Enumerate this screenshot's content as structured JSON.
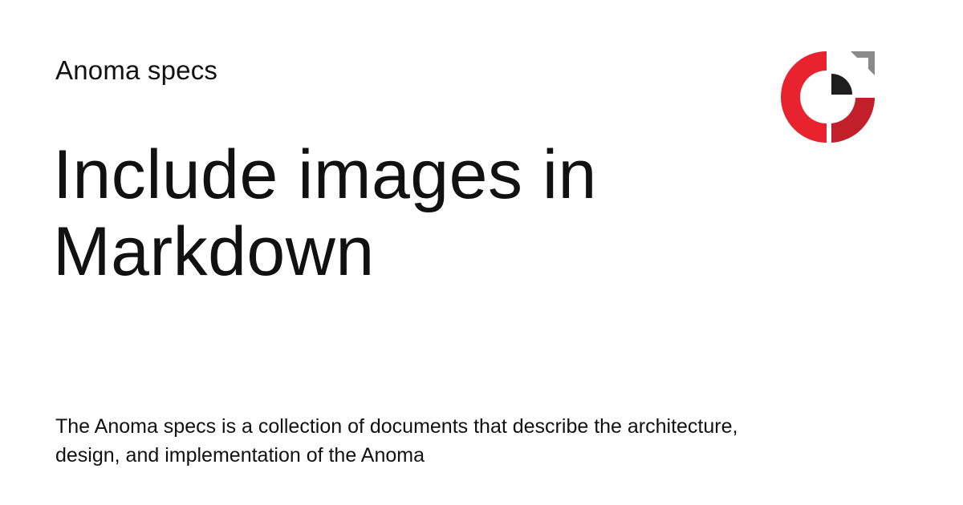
{
  "header": {
    "site_name": "Anoma specs"
  },
  "main": {
    "title": "Include images in Markdown",
    "description": "The Anoma specs is a collection of documents that describe the architecture, design, and implementation of the Anoma"
  },
  "logo": {
    "icon": "anoma-logo-icon",
    "colors": {
      "red": "#E8222E",
      "dark_red": "#C1202B",
      "black": "#1E1E1E",
      "gray": "#8A8A8A"
    }
  }
}
